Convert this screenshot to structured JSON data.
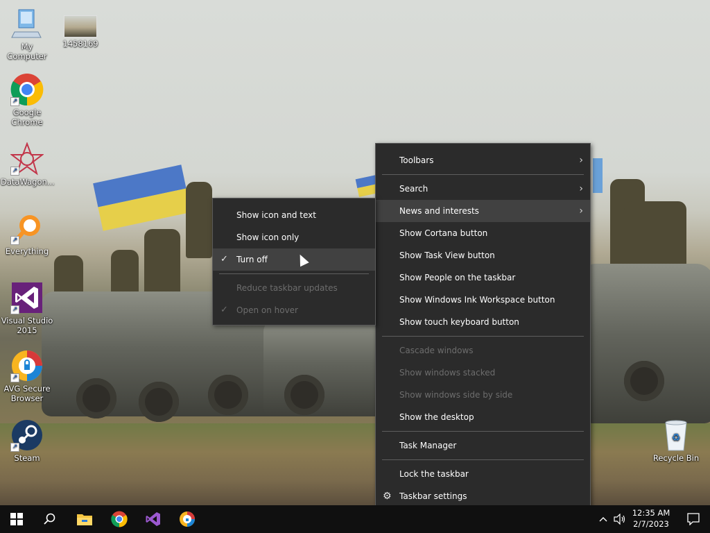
{
  "desktop_icons": [
    {
      "label": "My Computer",
      "icon": "computer-icon"
    },
    {
      "label": "1458169",
      "icon": "image-thumbnail-icon"
    },
    {
      "label": "Google Chrome",
      "icon": "chrome-icon"
    },
    {
      "label": "DataWagon...",
      "icon": "datawagon-icon"
    },
    {
      "label": "Everything",
      "icon": "everything-search-icon"
    },
    {
      "label": "Visual Studio 2015",
      "icon": "visual-studio-icon"
    },
    {
      "label": "AVG Secure Browser",
      "icon": "avg-browser-icon"
    },
    {
      "label": "Steam",
      "icon": "steam-icon"
    },
    {
      "label": "Recycle Bin",
      "icon": "recycle-bin-icon"
    }
  ],
  "taskbar_menu": {
    "items": [
      {
        "label": "Toolbars",
        "submenu": true
      },
      {
        "label": "Search",
        "submenu": true
      },
      {
        "label": "News and interests",
        "submenu": true
      },
      {
        "label": "Show Cortana button"
      },
      {
        "label": "Show Task View button"
      },
      {
        "label": "Show People on the taskbar"
      },
      {
        "label": "Show Windows Ink Workspace button"
      },
      {
        "label": "Show touch keyboard button"
      },
      {
        "label": "Cascade windows"
      },
      {
        "label": "Show windows stacked"
      },
      {
        "label": "Show windows side by side"
      },
      {
        "label": "Show the desktop"
      },
      {
        "label": "Task Manager"
      },
      {
        "label": "Lock the taskbar"
      },
      {
        "label": "Taskbar settings"
      }
    ]
  },
  "news_submenu": {
    "items": [
      {
        "label": "Show icon and text"
      },
      {
        "label": "Show icon only"
      },
      {
        "label": "Turn off",
        "checked": true
      },
      {
        "label": "Reduce taskbar updates"
      },
      {
        "label": "Open on hover",
        "checked": true
      }
    ]
  },
  "taskbar": {
    "pinned": [
      "start-icon",
      "search-icon",
      "file-explorer-icon",
      "chrome-icon",
      "visual-studio-icon",
      "avg-browser-icon"
    ],
    "time": "12:35 AM",
    "date": "2/7/2023"
  },
  "glyphs": {
    "arrow": "›",
    "check": "✓",
    "gear": "⚙",
    "shortcut": "↗",
    "search": "⚲",
    "chevron_up": "︿",
    "volume": "🔈",
    "notification": "🗨"
  }
}
